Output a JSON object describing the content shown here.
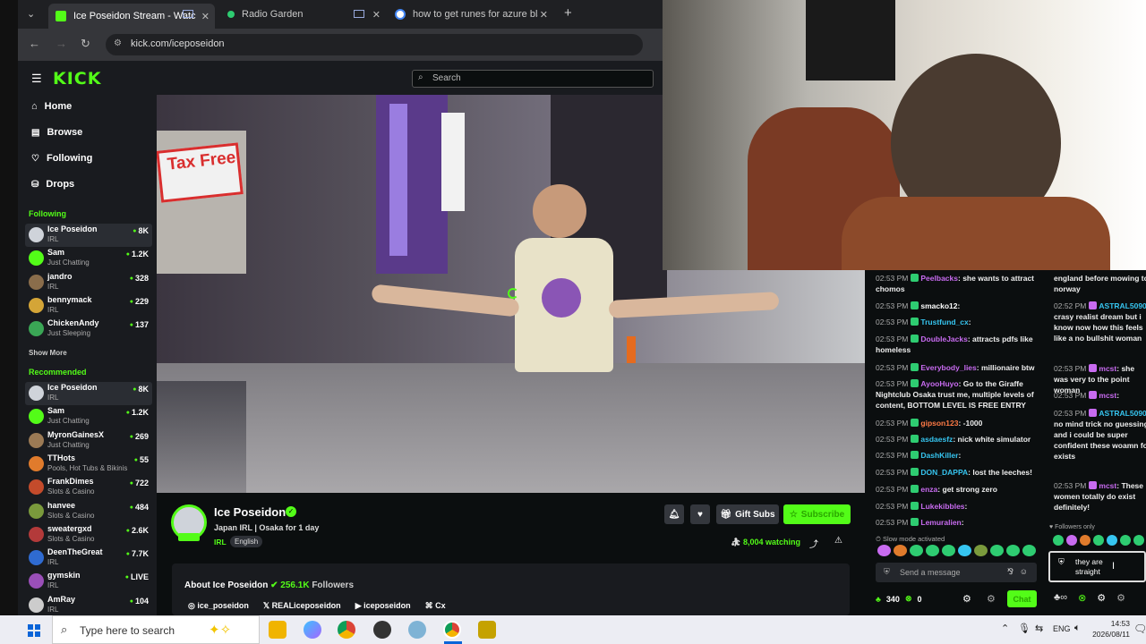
{
  "browser": {
    "tabs": [
      {
        "title": "Ice Poseidon Stream - Watc",
        "favicon_color": "#53fc18"
      },
      {
        "title": "Radio Garden",
        "favicon_color": "#2ecc71"
      },
      {
        "title": "how to get runes for azure blad",
        "favicon_color": "#4285f4"
      }
    ],
    "url": "kick.com/iceposeidon"
  },
  "kick": {
    "logo": "KICK",
    "search_placeholder": "Search",
    "nav": [
      {
        "label": "Home",
        "icon": "home-icon"
      },
      {
        "label": "Browse",
        "icon": "browse-icon"
      },
      {
        "label": "Following",
        "icon": "heart-icon"
      },
      {
        "label": "Drops",
        "icon": "drops-icon"
      }
    ],
    "following_title": "Following",
    "following": [
      {
        "name": "Ice Poseidon",
        "category": "IRL",
        "viewers": "8K",
        "color": "#cfd3da"
      },
      {
        "name": "Sam",
        "category": "Just Chatting",
        "viewers": "1.2K",
        "color": "#53fc18"
      },
      {
        "name": "jandro",
        "category": "IRL",
        "viewers": "328",
        "color": "#8a6d4b"
      },
      {
        "name": "bennymack",
        "category": "IRL",
        "viewers": "229",
        "color": "#d4a537"
      },
      {
        "name": "ChickenAndy",
        "category": "Just Sleeping",
        "viewers": "137",
        "color": "#3aa655"
      }
    ],
    "show_more": "Show More",
    "recommended_title": "Recommended",
    "recommended": [
      {
        "name": "Ice Poseidon",
        "category": "IRL",
        "viewers": "8K",
        "color": "#cfd3da"
      },
      {
        "name": "Sam",
        "category": "Just Chatting",
        "viewers": "1.2K",
        "color": "#53fc18"
      },
      {
        "name": "MyronGainesX",
        "category": "Just Chatting",
        "viewers": "269",
        "color": "#9b7a55"
      },
      {
        "name": "TTHots",
        "category": "Pools, Hot Tubs & Bikinis",
        "viewers": "55",
        "color": "#e07b2c"
      },
      {
        "name": "FrankDimes",
        "category": "Slots & Casino",
        "viewers": "722",
        "color": "#c44b2b"
      },
      {
        "name": "hanvee",
        "category": "Slots & Casino",
        "viewers": "484",
        "color": "#7a9a3c"
      },
      {
        "name": "sweatergxd",
        "category": "Slots & Casino",
        "viewers": "2.6K",
        "color": "#b33a3a"
      },
      {
        "name": "DeenTheGreat",
        "category": "IRL",
        "viewers": "7.7K",
        "color": "#2f6bd1"
      },
      {
        "name": "gymskin",
        "category": "IRL",
        "viewers": "LIVE",
        "color": "#9a4fb8"
      },
      {
        "name": "AmRay",
        "category": "IRL",
        "viewers": "104",
        "color": "#cccccc"
      }
    ],
    "stream": {
      "streamer": "Ice Poseidon",
      "title": "Japan IRL | Osaka for 1 day",
      "category": "IRL",
      "tag": "English",
      "watching": "8,004 watching",
      "gift_subs": "Gift Subs",
      "subscribe": "Subscribe",
      "video_sign": "Tax Free",
      "about_title": "About Ice Poseidon",
      "followers_count": "256.1K",
      "followers_label": "Followers",
      "socials": [
        {
          "icon": "instagram-icon",
          "label": "ice_poseidon"
        },
        {
          "icon": "x-icon",
          "label": "REALiceposeidon"
        },
        {
          "icon": "youtube-icon",
          "label": "iceposeidon"
        },
        {
          "icon": "kick-icon",
          "label": "Cx"
        }
      ]
    },
    "chat": {
      "messages": [
        {
          "time": "02:53 PM",
          "user": "Peelbacks",
          "user_color": "#c86bf0",
          "text": "she wants to attract chomos"
        },
        {
          "time": "02:53 PM",
          "user": "smacko12",
          "user_color": "#ffffff",
          "text": ""
        },
        {
          "time": "02:53 PM",
          "user": "Trustfund_cx",
          "user_color": "#36c5f0",
          "text": ""
        },
        {
          "time": "02:53 PM",
          "user": "DoubleJacks",
          "user_color": "#c86bf0",
          "text": "attracts pdfs like homeless"
        },
        {
          "time": "02:53 PM",
          "user": "Everybody_lies",
          "user_color": "#c86bf0",
          "text": "millionaire btw"
        },
        {
          "time": "02:53 PM",
          "user": "AyooHuyo",
          "user_color": "#c86bf0",
          "text": "Go to the Giraffe Nightclub Osaka trust me, multiple levels of content, BOTTOM LEVEL IS FREE ENTRY"
        },
        {
          "time": "02:53 PM",
          "user": "gipson123",
          "user_color": "#ff7a45",
          "text": "-1000"
        },
        {
          "time": "02:53 PM",
          "user": "asdaesfz",
          "user_color": "#36c5f0",
          "text": "nick white simulator"
        },
        {
          "time": "02:53 PM",
          "user": "DashKiller",
          "user_color": "#36c5f0",
          "text": ""
        },
        {
          "time": "02:53 PM",
          "user": "DON_DAPPA",
          "user_color": "#36c5f0",
          "text": "lost the leeches!"
        },
        {
          "time": "02:53 PM",
          "user": "enza",
          "user_color": "#c86bf0",
          "text": "get strong zero"
        },
        {
          "time": "02:53 PM",
          "user": "Lukekibbles",
          "user_color": "#c86bf0",
          "text": ""
        },
        {
          "time": "02:53 PM",
          "user": "Lemuralien",
          "user_color": "#c86bf0",
          "text": ""
        }
      ],
      "slow_mode": "Slow mode activated",
      "placeholder": "Send a message",
      "points": "340",
      "kicks": "0",
      "chat_button": "Chat"
    },
    "chat2": {
      "messages": [
        {
          "time": "",
          "user": "",
          "user_color": "#ffffff",
          "text": "england before mowing to norway"
        },
        {
          "time": "02:52 PM",
          "user": "ASTRAL5090",
          "user_color": "#36c5f0",
          "text": "crasy realist dream but i know now how this feels like a no bullshit woman"
        },
        {
          "time": "02:53 PM",
          "user": "mcst",
          "user_color": "#c86bf0",
          "text": "she was very to the point woman"
        },
        {
          "time": "02:53 PM",
          "user": "mcst",
          "user_color": "#c86bf0",
          "text": ""
        },
        {
          "time": "02:53 PM",
          "user": "ASTRAL5090",
          "user_color": "#36c5f0",
          "text": "no mind trick no guessing and i could be super confident these woamn fo exists"
        },
        {
          "time": "02:53 PM",
          "user": "mcst",
          "user_color": "#c86bf0",
          "text": "These women totally do exist definitely!"
        }
      ],
      "followers_only": "Followers only",
      "input_text": "they are straight"
    }
  },
  "taskbar": {
    "search_placeholder": "Type here to search",
    "lang": "ENG",
    "time": "14:53",
    "date": "2026/08/11"
  }
}
